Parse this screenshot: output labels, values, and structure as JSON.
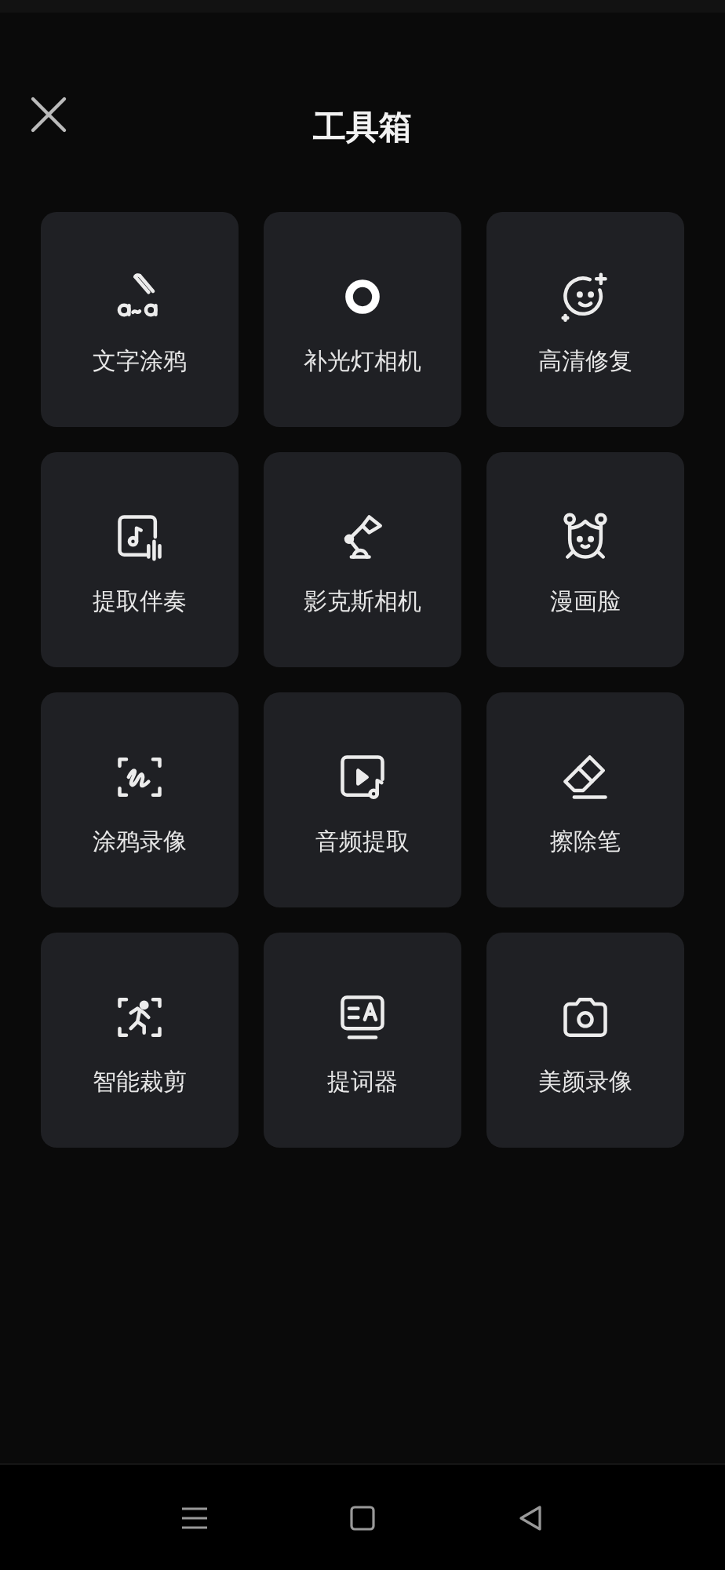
{
  "header": {
    "title": "工具箱"
  },
  "tools": [
    {
      "label": "文字涂鸦"
    },
    {
      "label": "补光灯相机"
    },
    {
      "label": "高清修复"
    },
    {
      "label": "提取伴奏"
    },
    {
      "label": "影克斯相机"
    },
    {
      "label": "漫画脸"
    },
    {
      "label": "涂鸦录像"
    },
    {
      "label": "音频提取"
    },
    {
      "label": "擦除笔"
    },
    {
      "label": "智能裁剪"
    },
    {
      "label": "提词器"
    },
    {
      "label": "美颜录像"
    }
  ]
}
